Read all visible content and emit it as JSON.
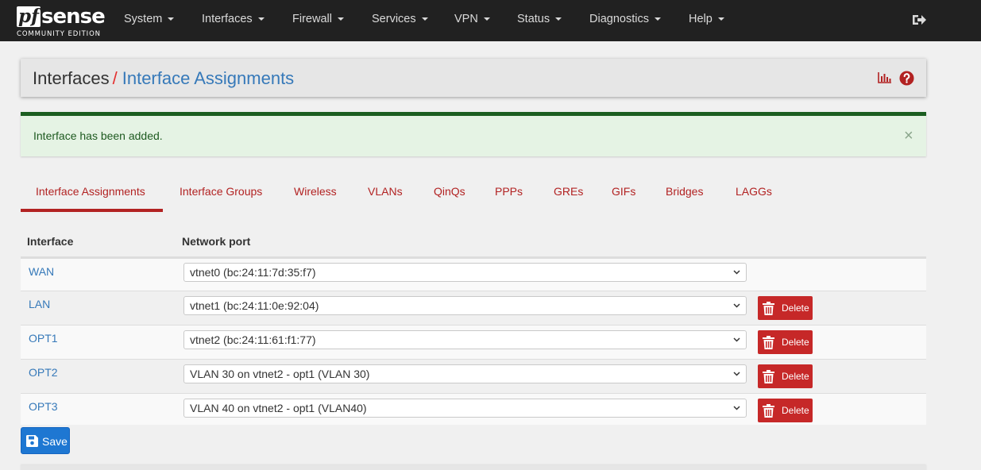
{
  "brand": {
    "name_pf": "pf",
    "name_sense": "sense",
    "edition": "COMMUNITY EDITION"
  },
  "nav": {
    "items": [
      {
        "label": "System"
      },
      {
        "label": "Interfaces"
      },
      {
        "label": "Firewall"
      },
      {
        "label": "Services"
      },
      {
        "label": "VPN"
      },
      {
        "label": "Status"
      },
      {
        "label": "Diagnostics"
      },
      {
        "label": "Help"
      }
    ],
    "logout_icon": "sign-out-icon"
  },
  "header": {
    "root": "Interfaces",
    "separator": "/",
    "title": "Interface Assignments",
    "icons": [
      "bar-chart-icon",
      "question-circle-icon"
    ]
  },
  "alert": {
    "message": "Interface has been added.",
    "close": "×"
  },
  "tabs": [
    {
      "label": "Interface Assignments",
      "active": true
    },
    {
      "label": "Interface Groups"
    },
    {
      "label": "Wireless"
    },
    {
      "label": "VLANs"
    },
    {
      "label": "QinQs"
    },
    {
      "label": "PPPs"
    },
    {
      "label": "GREs"
    },
    {
      "label": "GIFs"
    },
    {
      "label": "Bridges"
    },
    {
      "label": "LAGGs"
    }
  ],
  "table": {
    "columns": [
      "Interface",
      "Network port"
    ],
    "rows": [
      {
        "interface": "WAN",
        "port": "vtnet0 (bc:24:11:7d:35:f7)",
        "has_delete": false
      },
      {
        "interface": "LAN",
        "port": "vtnet1 (bc:24:11:0e:92:04)",
        "delete_label": "Delete"
      },
      {
        "interface": "OPT1",
        "port": "vtnet2 (bc:24:11:61:f1:77)",
        "delete_label": "Delete"
      },
      {
        "interface": "OPT2",
        "port": "VLAN 30 on vtnet2 - opt1 (VLAN 30)",
        "delete_label": "Delete"
      },
      {
        "interface": "OPT3",
        "port": "VLAN 40 on vtnet2 - opt1 (VLAN40)",
        "delete_label": "Delete"
      }
    ]
  },
  "save": {
    "label": "Save",
    "icon": "floppy-disk-icon"
  },
  "colors": {
    "navbar": "#212121",
    "link_blue": "#3679b9",
    "tab_red": "#b22222",
    "delete_red": "#c62828",
    "save_blue": "#1e77d2",
    "alert_green": "#1b5e20"
  }
}
